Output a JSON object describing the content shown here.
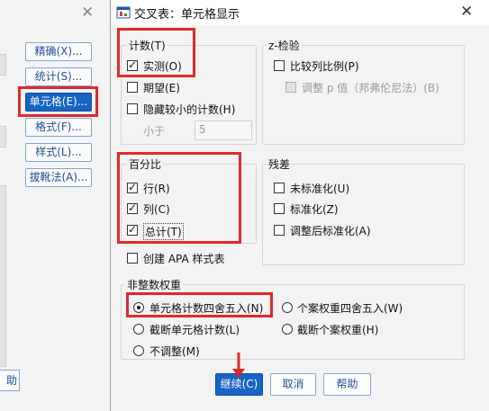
{
  "background_window": {
    "side_buttons": [
      {
        "label": "精确(X)..."
      },
      {
        "label": "统计(S)..."
      },
      {
        "label": "单元格(E)..."
      },
      {
        "label": "格式(F)..."
      },
      {
        "label": "样式(L)..."
      },
      {
        "label": "拔靴法(A)..."
      }
    ],
    "help_label": "助",
    "selected_button": "单元格(E)..."
  },
  "dialog": {
    "title": "交叉表：单元格显示",
    "counts": {
      "title": "计数(T)",
      "observed": {
        "label": "实测(O)",
        "checked": true
      },
      "expected": {
        "label": "期望(E)",
        "checked": false
      },
      "hide_small": {
        "label": "隐藏较小的计数(H)",
        "checked": false
      },
      "less_than": {
        "label": "小于",
        "value": "5"
      }
    },
    "z_test": {
      "title": "z-检验",
      "compare": {
        "label": "比较列比例(P)",
        "checked": false
      },
      "adjust": {
        "label": "调整 p 值（邦弗伦尼法）(B)",
        "checked": false,
        "disabled": true
      }
    },
    "percentages": {
      "title": "百分比",
      "row": {
        "label": "行(R)",
        "checked": true
      },
      "column": {
        "label": "列(C)",
        "checked": true
      },
      "total": {
        "label": "总计(T)",
        "checked": true
      }
    },
    "apa": {
      "label": "创建 APA 样式表",
      "checked": false
    },
    "residuals": {
      "title": "残差",
      "unstandardized": {
        "label": "未标准化(U)",
        "checked": false
      },
      "standardized": {
        "label": "标准化(Z)",
        "checked": false
      },
      "adjusted": {
        "label": "调整后标准化(A)",
        "checked": false
      }
    },
    "noninteger": {
      "title": "非整数权重",
      "options": [
        {
          "label": "单元格计数四舍五入(N)",
          "selected": true
        },
        {
          "label": "个案权重四舍五入(W)",
          "selected": false
        },
        {
          "label": "截断单元格计数(L)",
          "selected": false
        },
        {
          "label": "截断个案权重(H)",
          "selected": false
        },
        {
          "label": "不调整(M)",
          "selected": false
        }
      ]
    },
    "buttons": {
      "continue": "继续(C)",
      "cancel": "取消",
      "help": "帮助"
    }
  },
  "colors": {
    "accent": "#1764c3",
    "highlight": "#e02a2a",
    "dialog_bg": "#f3f3f3"
  }
}
